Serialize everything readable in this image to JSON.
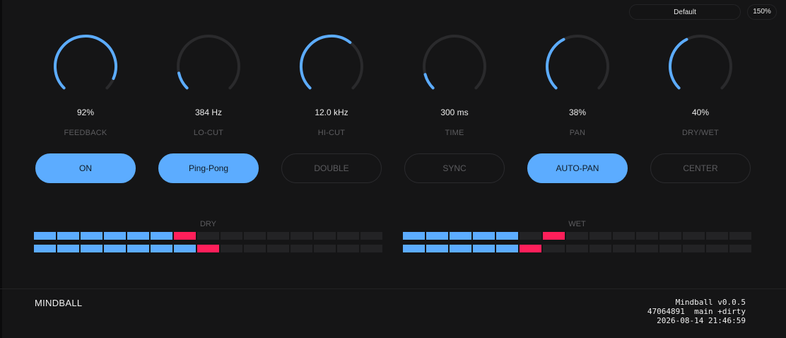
{
  "colors": {
    "accent": "#5cacff",
    "peak": "#ff1f5a",
    "track": "#2a2a2c",
    "meter_off": "#232325",
    "background": "#151516"
  },
  "top_bar": {
    "preset": "Default",
    "zoom": "150%"
  },
  "knobs": [
    {
      "name": "feedback",
      "value_text": "92%",
      "label": "FEEDBACK",
      "level": 0.92
    },
    {
      "name": "lo-cut",
      "value_text": "384 Hz",
      "label": "LO-CUT",
      "level": 0.12
    },
    {
      "name": "hi-cut",
      "value_text": "12.0 kHz",
      "label": "HI-CUT",
      "level": 0.64
    },
    {
      "name": "time",
      "value_text": "300 ms",
      "label": "TIME",
      "level": 0.11
    },
    {
      "name": "pan",
      "value_text": "38%",
      "label": "PAN",
      "level": 0.4
    },
    {
      "name": "dry-wet",
      "value_text": "40%",
      "label": "DRY/WET",
      "level": 0.4
    }
  ],
  "toggles": [
    {
      "name": "on",
      "label": "ON",
      "active": true
    },
    {
      "name": "ping-pong",
      "label": "Ping-Pong",
      "active": true
    },
    {
      "name": "double",
      "label": "DOUBLE",
      "active": false
    },
    {
      "name": "sync",
      "label": "SYNC",
      "active": false
    },
    {
      "name": "auto-pan",
      "label": "AUTO-PAN",
      "active": true
    },
    {
      "name": "center",
      "label": "CENTER",
      "active": false
    }
  ],
  "meters": [
    {
      "name": "dry",
      "label": "DRY",
      "segments": 15,
      "rows": [
        {
          "lit": 6,
          "peak": 6
        },
        {
          "lit": 7,
          "peak": 7
        }
      ]
    },
    {
      "name": "wet",
      "label": "WET",
      "segments": 15,
      "rows": [
        {
          "lit": 5,
          "peak": 6
        },
        {
          "lit": 5,
          "peak": 5
        }
      ]
    }
  ],
  "footer": {
    "brand": "MINDBALL",
    "version_line1": "Mindball v0.0.5",
    "version_line2": "47064891  main +dirty",
    "version_line3": "2026-08-14 21:46:59"
  }
}
